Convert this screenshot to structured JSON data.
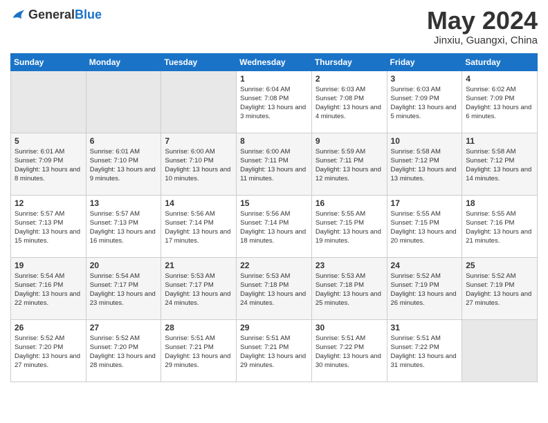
{
  "header": {
    "logo": {
      "text_general": "General",
      "text_blue": "Blue"
    },
    "title": "May 2024",
    "location": "Jinxiu, Guangxi, China"
  },
  "calendar": {
    "days_of_week": [
      "Sunday",
      "Monday",
      "Tuesday",
      "Wednesday",
      "Thursday",
      "Friday",
      "Saturday"
    ],
    "weeks": [
      [
        {
          "day": "",
          "sunrise": "",
          "sunset": "",
          "daylight": ""
        },
        {
          "day": "",
          "sunrise": "",
          "sunset": "",
          "daylight": ""
        },
        {
          "day": "",
          "sunrise": "",
          "sunset": "",
          "daylight": ""
        },
        {
          "day": "1",
          "sunrise": "Sunrise: 6:04 AM",
          "sunset": "Sunset: 7:08 PM",
          "daylight": "Daylight: 13 hours and 3 minutes."
        },
        {
          "day": "2",
          "sunrise": "Sunrise: 6:03 AM",
          "sunset": "Sunset: 7:08 PM",
          "daylight": "Daylight: 13 hours and 4 minutes."
        },
        {
          "day": "3",
          "sunrise": "Sunrise: 6:03 AM",
          "sunset": "Sunset: 7:09 PM",
          "daylight": "Daylight: 13 hours and 5 minutes."
        },
        {
          "day": "4",
          "sunrise": "Sunrise: 6:02 AM",
          "sunset": "Sunset: 7:09 PM",
          "daylight": "Daylight: 13 hours and 6 minutes."
        }
      ],
      [
        {
          "day": "5",
          "sunrise": "Sunrise: 6:01 AM",
          "sunset": "Sunset: 7:09 PM",
          "daylight": "Daylight: 13 hours and 8 minutes."
        },
        {
          "day": "6",
          "sunrise": "Sunrise: 6:01 AM",
          "sunset": "Sunset: 7:10 PM",
          "daylight": "Daylight: 13 hours and 9 minutes."
        },
        {
          "day": "7",
          "sunrise": "Sunrise: 6:00 AM",
          "sunset": "Sunset: 7:10 PM",
          "daylight": "Daylight: 13 hours and 10 minutes."
        },
        {
          "day": "8",
          "sunrise": "Sunrise: 6:00 AM",
          "sunset": "Sunset: 7:11 PM",
          "daylight": "Daylight: 13 hours and 11 minutes."
        },
        {
          "day": "9",
          "sunrise": "Sunrise: 5:59 AM",
          "sunset": "Sunset: 7:11 PM",
          "daylight": "Daylight: 13 hours and 12 minutes."
        },
        {
          "day": "10",
          "sunrise": "Sunrise: 5:58 AM",
          "sunset": "Sunset: 7:12 PM",
          "daylight": "Daylight: 13 hours and 13 minutes."
        },
        {
          "day": "11",
          "sunrise": "Sunrise: 5:58 AM",
          "sunset": "Sunset: 7:12 PM",
          "daylight": "Daylight: 13 hours and 14 minutes."
        }
      ],
      [
        {
          "day": "12",
          "sunrise": "Sunrise: 5:57 AM",
          "sunset": "Sunset: 7:13 PM",
          "daylight": "Daylight: 13 hours and 15 minutes."
        },
        {
          "day": "13",
          "sunrise": "Sunrise: 5:57 AM",
          "sunset": "Sunset: 7:13 PM",
          "daylight": "Daylight: 13 hours and 16 minutes."
        },
        {
          "day": "14",
          "sunrise": "Sunrise: 5:56 AM",
          "sunset": "Sunset: 7:14 PM",
          "daylight": "Daylight: 13 hours and 17 minutes."
        },
        {
          "day": "15",
          "sunrise": "Sunrise: 5:56 AM",
          "sunset": "Sunset: 7:14 PM",
          "daylight": "Daylight: 13 hours and 18 minutes."
        },
        {
          "day": "16",
          "sunrise": "Sunrise: 5:55 AM",
          "sunset": "Sunset: 7:15 PM",
          "daylight": "Daylight: 13 hours and 19 minutes."
        },
        {
          "day": "17",
          "sunrise": "Sunrise: 5:55 AM",
          "sunset": "Sunset: 7:15 PM",
          "daylight": "Daylight: 13 hours and 20 minutes."
        },
        {
          "day": "18",
          "sunrise": "Sunrise: 5:55 AM",
          "sunset": "Sunset: 7:16 PM",
          "daylight": "Daylight: 13 hours and 21 minutes."
        }
      ],
      [
        {
          "day": "19",
          "sunrise": "Sunrise: 5:54 AM",
          "sunset": "Sunset: 7:16 PM",
          "daylight": "Daylight: 13 hours and 22 minutes."
        },
        {
          "day": "20",
          "sunrise": "Sunrise: 5:54 AM",
          "sunset": "Sunset: 7:17 PM",
          "daylight": "Daylight: 13 hours and 23 minutes."
        },
        {
          "day": "21",
          "sunrise": "Sunrise: 5:53 AM",
          "sunset": "Sunset: 7:17 PM",
          "daylight": "Daylight: 13 hours and 24 minutes."
        },
        {
          "day": "22",
          "sunrise": "Sunrise: 5:53 AM",
          "sunset": "Sunset: 7:18 PM",
          "daylight": "Daylight: 13 hours and 24 minutes."
        },
        {
          "day": "23",
          "sunrise": "Sunrise: 5:53 AM",
          "sunset": "Sunset: 7:18 PM",
          "daylight": "Daylight: 13 hours and 25 minutes."
        },
        {
          "day": "24",
          "sunrise": "Sunrise: 5:52 AM",
          "sunset": "Sunset: 7:19 PM",
          "daylight": "Daylight: 13 hours and 26 minutes."
        },
        {
          "day": "25",
          "sunrise": "Sunrise: 5:52 AM",
          "sunset": "Sunset: 7:19 PM",
          "daylight": "Daylight: 13 hours and 27 minutes."
        }
      ],
      [
        {
          "day": "26",
          "sunrise": "Sunrise: 5:52 AM",
          "sunset": "Sunset: 7:20 PM",
          "daylight": "Daylight: 13 hours and 27 minutes."
        },
        {
          "day": "27",
          "sunrise": "Sunrise: 5:52 AM",
          "sunset": "Sunset: 7:20 PM",
          "daylight": "Daylight: 13 hours and 28 minutes."
        },
        {
          "day": "28",
          "sunrise": "Sunrise: 5:51 AM",
          "sunset": "Sunset: 7:21 PM",
          "daylight": "Daylight: 13 hours and 29 minutes."
        },
        {
          "day": "29",
          "sunrise": "Sunrise: 5:51 AM",
          "sunset": "Sunset: 7:21 PM",
          "daylight": "Daylight: 13 hours and 29 minutes."
        },
        {
          "day": "30",
          "sunrise": "Sunrise: 5:51 AM",
          "sunset": "Sunset: 7:22 PM",
          "daylight": "Daylight: 13 hours and 30 minutes."
        },
        {
          "day": "31",
          "sunrise": "Sunrise: 5:51 AM",
          "sunset": "Sunset: 7:22 PM",
          "daylight": "Daylight: 13 hours and 31 minutes."
        },
        {
          "day": "",
          "sunrise": "",
          "sunset": "",
          "daylight": ""
        }
      ]
    ]
  }
}
